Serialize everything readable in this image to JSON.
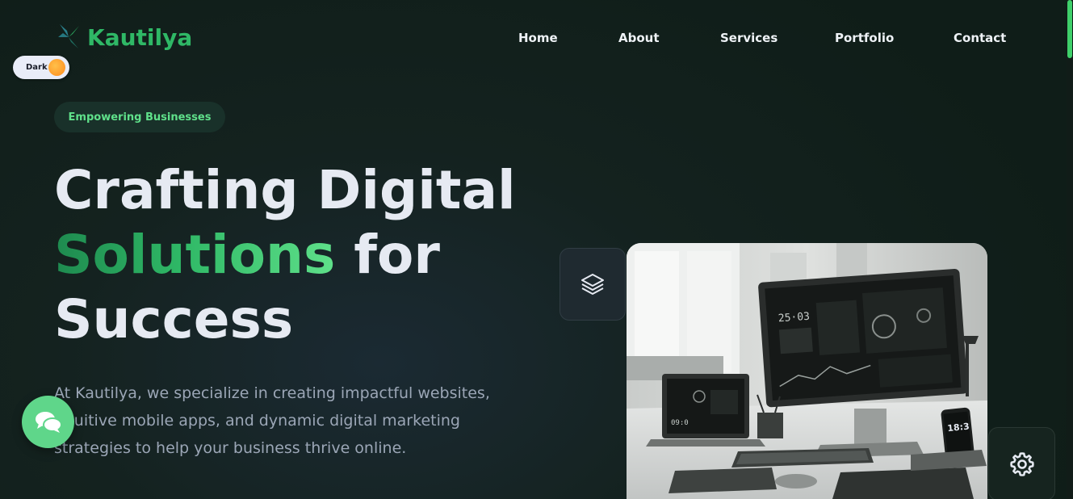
{
  "brand": {
    "name": "Kautilya",
    "accent": "#2fb866",
    "logo_icon": "pinwheel-logo-icon"
  },
  "theme_toggle": {
    "label": "Dark",
    "icon": "sun-icon"
  },
  "nav": [
    {
      "label": "Home"
    },
    {
      "label": "About"
    },
    {
      "label": "Services"
    },
    {
      "label": "Portfolio"
    },
    {
      "label": "Contact"
    }
  ],
  "hero": {
    "badge": "Empowering Businesses",
    "headline_line1": "Crafting Digital",
    "headline_highlight": "Solutions",
    "headline_line2_rest": " for",
    "headline_line3": "Success",
    "description": "At Kautilya, we specialize in creating impactful websites, intuitive mobile apps, and dynamic digital marketing strategies to help your business thrive online.",
    "image_screen_time": "25·03",
    "image_phone_time": "18:3"
  },
  "floating": {
    "chat_icon": "chat-bubbles-icon",
    "layers_icon": "layers-icon",
    "settings_icon": "gear-icon"
  },
  "colors": {
    "background": "#0f1d18",
    "text": "#e6eaf2",
    "muted": "#9ba6b6",
    "badge_text": "#5fe08a"
  }
}
